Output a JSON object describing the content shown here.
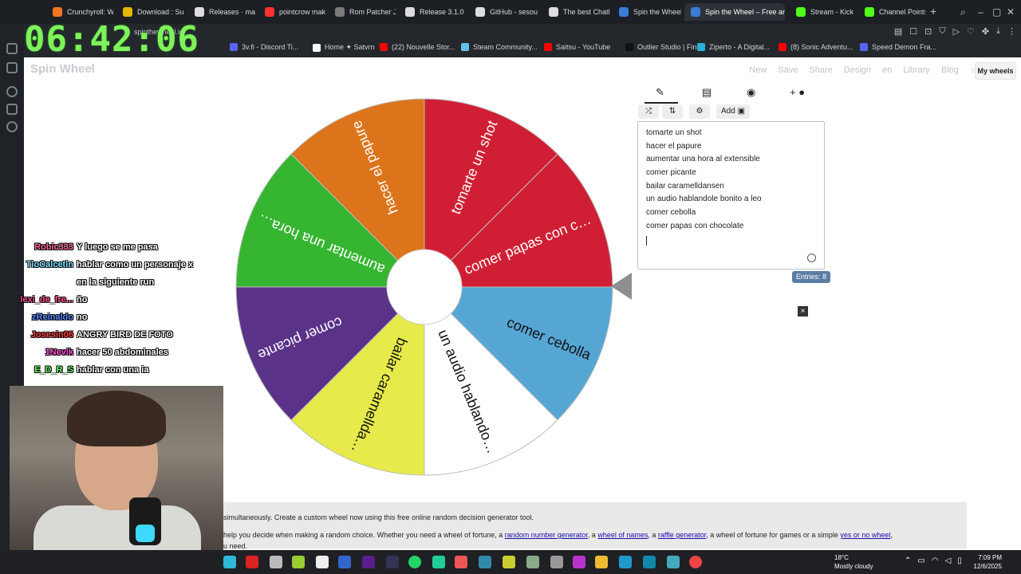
{
  "browser": {
    "tabs": [
      {
        "label": "Crunchyroll: Wa",
        "color": "#f47521"
      },
      {
        "label": "Download : Su",
        "color": "#e6b800"
      },
      {
        "label": "Releases · mars",
        "color": "#dddddd"
      },
      {
        "label": "pointcrow mak",
        "color": "#ff3030"
      },
      {
        "label": "Rom Patcher JS",
        "color": "#7a7a7a"
      },
      {
        "label": "Release 3.1.0",
        "color": "#dddddd"
      },
      {
        "label": "GitHub - sesou",
        "color": "#dddddd"
      },
      {
        "label": "The best ChatB",
        "color": "#dddddd"
      },
      {
        "label": "Spin the Wheel",
        "color": "#3a7bd5"
      },
      {
        "label": "Spin the Wheel – Free an",
        "color": "#3a7bd5"
      },
      {
        "label": "Stream - Kick",
        "color": "#53fc18"
      },
      {
        "label": "Channel Points",
        "color": "#53fc18"
      }
    ],
    "new_tab_symbol": "+",
    "url": "spinthewheel.io",
    "bookmarks": [
      {
        "label": "3v.fi - Discord Ti...",
        "color": "#5865f2"
      },
      {
        "label": "Home ✦ Satvrn",
        "color": "#ffffff"
      },
      {
        "label": "(22) Nouvelle Stor...",
        "color": "#ff0000"
      },
      {
        "label": "Steam Community...",
        "color": "#66c0f4"
      },
      {
        "label": "Saitsu - YouTube",
        "color": "#ff0000"
      },
      {
        "label": "Outlier Studio | Fin...",
        "color": "#111111"
      },
      {
        "label": "Ziperto - A Digital...",
        "color": "#2ab0d8"
      },
      {
        "label": "(8) Sonic Adventu...",
        "color": "#ff0000"
      },
      {
        "label": "Speed Demon Fra...",
        "color": "#5865f2"
      }
    ]
  },
  "overlay_clock": "06:42:06",
  "app": {
    "brand": "Spin Wheel",
    "nav": [
      "New",
      "Save",
      "Share",
      "Design",
      "en",
      "Library",
      "Blog"
    ],
    "my_wheels": "My wheels",
    "add_label": "Add",
    "entries": [
      "tomarte un shot",
      "hacer el papure",
      "aumentar una hora al extensible",
      "comer picante",
      "bailar caramelldansen",
      "un audio hablandole bonito a leo",
      "comer cebolla",
      "comer papas con chocolate"
    ],
    "entries_count": "Entries: 8",
    "close_symbol": "×"
  },
  "wheel": {
    "slices": [
      {
        "label": "comer papas con c…",
        "color": "#d01f35"
      },
      {
        "label": "comer cebolla",
        "color": "#56a6d4"
      },
      {
        "label": "un audio hablando…",
        "color": "#ffffff"
      },
      {
        "label": "bailar caramellda…",
        "color": "#e6ea4a"
      },
      {
        "label": "comer picante",
        "color": "#5a3288"
      },
      {
        "label": "aumentar una hora…",
        "color": "#36b531"
      },
      {
        "label": "hacer el papure",
        "color": "#dc741b"
      },
      {
        "label": "tomarte un shot",
        "color": "#d01f35"
      }
    ]
  },
  "description": {
    "line1": "simultaneously. Create a custom wheel now using this free online random decision generator tool.",
    "line2_prefix": "help you decide when making a random choice. Whether you need a wheel of fortune, a",
    "link1": "random number generator",
    "mid1": ", a",
    "link2": "wheel of names",
    "mid2": ", a",
    "link3": "raffle generator",
    "mid3": ", a wheel of fortune for games or a simple",
    "link4": "yes or no wheel",
    "line3": "u need."
  },
  "chat": [
    {
      "user": "Robic333",
      "msg": "Y luego se me pasa",
      "color": "#ff6b9d"
    },
    {
      "user": "TioCalcetin",
      "msg": "hablar como un personaje x",
      "color": "#7ce3ff"
    },
    {
      "user": "",
      "msg": "en la siguiente run",
      "color": "#ffffff"
    },
    {
      "user": "lexi_de_fre...",
      "msg": "ño",
      "color": "#ff4f8f"
    },
    {
      "user": "zReinaldo",
      "msg": "no",
      "color": "#5f8dff"
    },
    {
      "user": "Josesin06",
      "msg": "ANGRY BIRD DE FOTO",
      "color": "#ff3e3e"
    },
    {
      "user": "1Nevik",
      "msg": "hacer 50 abdominales",
      "color": "#ff4fd0"
    },
    {
      "user": "E_D_R_S",
      "msg": "hablar con una ia",
      "color": "#6cff6c"
    }
  ],
  "taskbar": {
    "weather_temp": "18°C",
    "weather_desc": "Mostly cloudy",
    "time": "7:09 PM",
    "date": "12/6/2025"
  }
}
